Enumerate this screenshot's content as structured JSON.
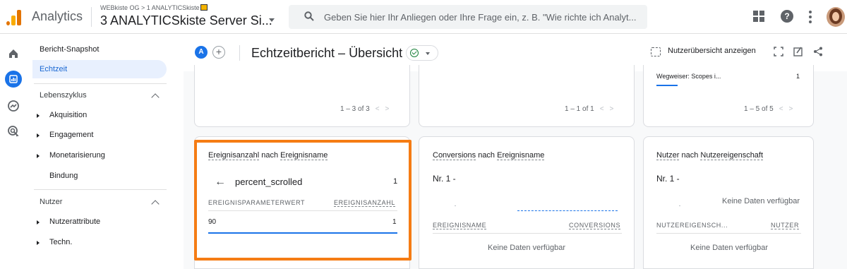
{
  "header": {
    "app_name": "Analytics",
    "account_path": "WEBkiste OG > 1 ANALYTICSkiste",
    "property_name": "3 ANALYTICSkiste Server Si...",
    "search_placeholder": "Geben Sie hier Ihr Anliegen oder Ihre Frage ein, z. B. \"Wie richte ich Analyt..."
  },
  "sidebar": {
    "snapshot": "Bericht-Snapshot",
    "active": "Echtzeit",
    "lifecycle": {
      "title": "Lebenszyklus",
      "items": [
        "Akquisition",
        "Engagement",
        "Monetarisierung",
        "Bindung"
      ]
    },
    "users": {
      "title": "Nutzer",
      "items": [
        "Nutzerattribute",
        "Techn."
      ]
    }
  },
  "subheader": {
    "badge": "A",
    "plus": "+",
    "title": "Echtzeitbericht – Übersicht",
    "user_overview": "Nutzerübersicht anzeigen"
  },
  "top_cards": {
    "card1_pager": "1 – 3 of 3",
    "card2_pager": "1 – 1 of 1",
    "card3_row_label": "Wegweiser: Scopes i...",
    "card3_row_value": "1",
    "card3_pager": "1 – 5 of 5"
  },
  "card_events": {
    "title_a": "Ereignisanzahl",
    "title_mid": " nach ",
    "title_b": "Ereignisname",
    "back_arrow": "←",
    "event_name": "percent_scrolled",
    "event_value": "1",
    "col_param": "EREIGNISPARAMETERWERT",
    "col_count": "EREIGNISANZAHL",
    "row_param": "90",
    "row_count": "1"
  },
  "card_conversions": {
    "title_a": "Conversions",
    "title_mid": " nach ",
    "title_b": "Ereignisname",
    "rank": "Nr. 1  -",
    "col_event": "EREIGNISNAME",
    "col_conv": "CONVERSIONS",
    "nodata": "Keine Daten verfügbar"
  },
  "card_user_props": {
    "title_a": "Nutzer",
    "title_mid": " nach ",
    "title_b": "Nutzereigenschaft",
    "rank": "Nr. 1  -",
    "nodata_top": "Keine Daten verfügbar",
    "col_prop": "NUTZEREIGENSCH...",
    "col_users": "NUTZER",
    "nodata": "Keine Daten verfügbar"
  },
  "colors": {
    "accent": "#1a73e8",
    "highlight": "#f57c14",
    "brand_orange": "#e37400",
    "brand_yellow": "#f9ab00"
  }
}
